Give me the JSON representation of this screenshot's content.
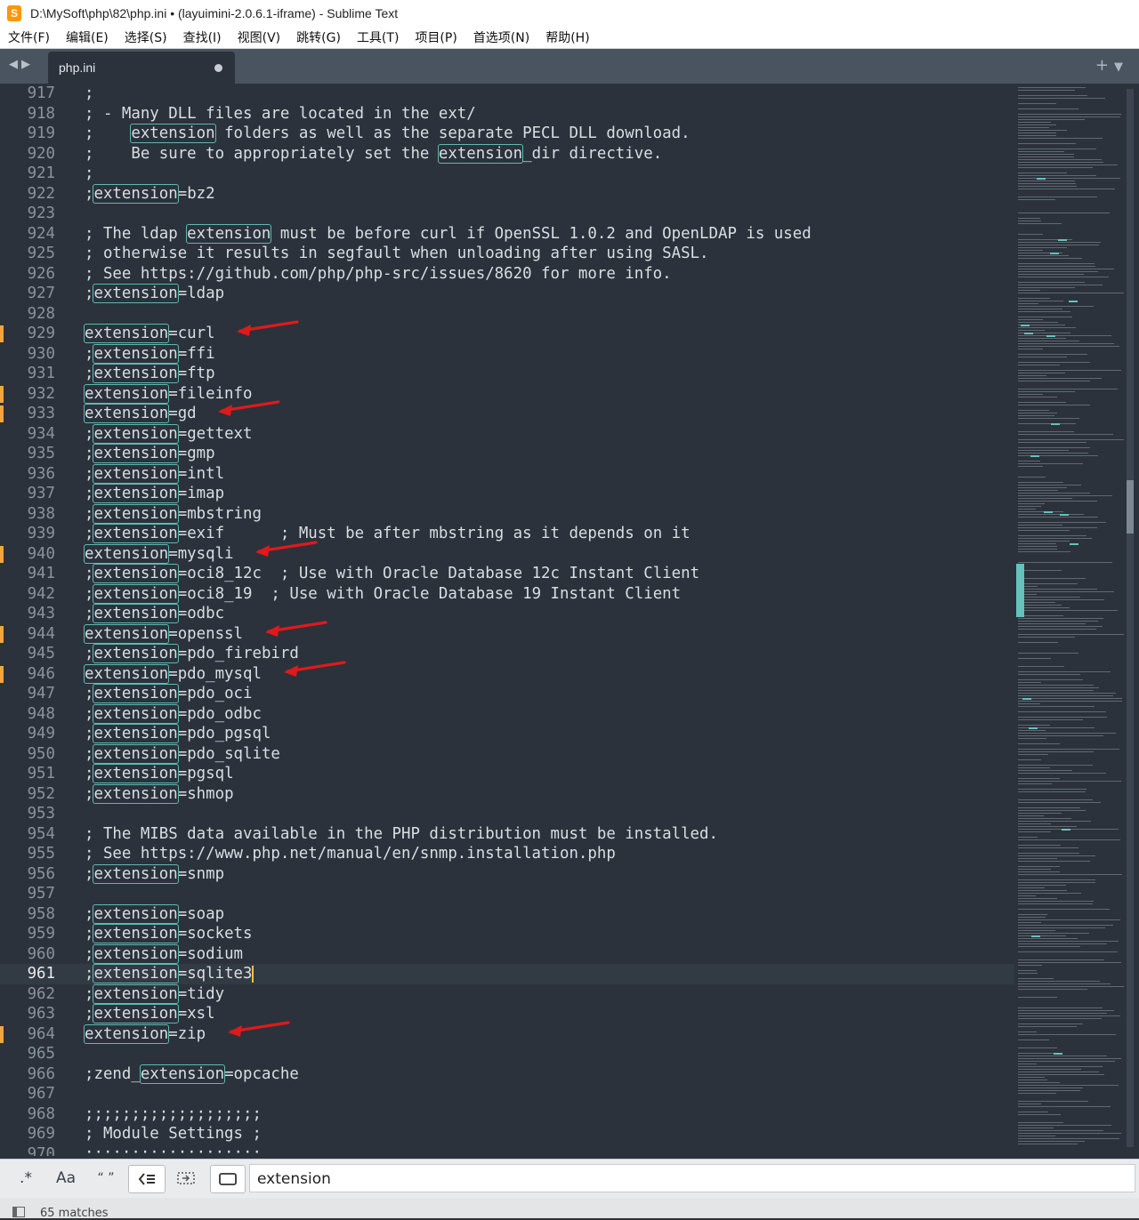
{
  "window": {
    "title": "D:\\MySoft\\php\\82\\php.ini • (layuimini-2.0.6.1-iframe) - Sublime Text",
    "app_icon": "S"
  },
  "menu": [
    "文件(F)",
    "编辑(E)",
    "选择(S)",
    "查找(I)",
    "视图(V)",
    "跳转(G)",
    "工具(T)",
    "项目(P)",
    "首选项(N)",
    "帮助(H)"
  ],
  "tab": {
    "label": "php.ini",
    "modified": true
  },
  "tab_controls": {
    "plus": "+",
    "dropdown": "▼"
  },
  "nav": {
    "back": "◀",
    "forward": "▶"
  },
  "highlight_term": "extension",
  "current_line": 961,
  "lines": [
    {
      "n": 917,
      "t": ";"
    },
    {
      "n": 918,
      "t": "; - Many DLL files are located in the ext/"
    },
    {
      "n": 919,
      "t": ";    extension folders as well as the separate PECL DLL download."
    },
    {
      "n": 920,
      "t": ";    Be sure to appropriately set the extension_dir directive."
    },
    {
      "n": 921,
      "t": ";"
    },
    {
      "n": 922,
      "t": ";extension=bz2"
    },
    {
      "n": 923,
      "t": ""
    },
    {
      "n": 924,
      "t": "; The ldap extension must be before curl if OpenSSL 1.0.2 and OpenLDAP is used"
    },
    {
      "n": 925,
      "t": "; otherwise it results in segfault when unloading after using SASL."
    },
    {
      "n": 926,
      "t": "; See https://github.com/php/php-src/issues/8620 for more info."
    },
    {
      "n": 927,
      "t": ";extension=ldap"
    },
    {
      "n": 928,
      "t": ""
    },
    {
      "n": 929,
      "t": "extension=curl",
      "mod": true
    },
    {
      "n": 930,
      "t": ";extension=ffi"
    },
    {
      "n": 931,
      "t": ";extension=ftp"
    },
    {
      "n": 932,
      "t": "extension=fileinfo",
      "mod": true
    },
    {
      "n": 933,
      "t": "extension=gd",
      "mod": true
    },
    {
      "n": 934,
      "t": ";extension=gettext"
    },
    {
      "n": 935,
      "t": ";extension=gmp"
    },
    {
      "n": 936,
      "t": ";extension=intl"
    },
    {
      "n": 937,
      "t": ";extension=imap"
    },
    {
      "n": 938,
      "t": ";extension=mbstring"
    },
    {
      "n": 939,
      "t": ";extension=exif      ; Must be after mbstring as it depends on it"
    },
    {
      "n": 940,
      "t": "extension=mysqli",
      "mod": true
    },
    {
      "n": 941,
      "t": ";extension=oci8_12c  ; Use with Oracle Database 12c Instant Client"
    },
    {
      "n": 942,
      "t": ";extension=oci8_19  ; Use with Oracle Database 19 Instant Client"
    },
    {
      "n": 943,
      "t": ";extension=odbc"
    },
    {
      "n": 944,
      "t": "extension=openssl",
      "mod": true
    },
    {
      "n": 945,
      "t": ";extension=pdo_firebird"
    },
    {
      "n": 946,
      "t": "extension=pdo_mysql",
      "mod": true
    },
    {
      "n": 947,
      "t": ";extension=pdo_oci"
    },
    {
      "n": 948,
      "t": ";extension=pdo_odbc"
    },
    {
      "n": 949,
      "t": ";extension=pdo_pgsql"
    },
    {
      "n": 950,
      "t": ";extension=pdo_sqlite"
    },
    {
      "n": 951,
      "t": ";extension=pgsql"
    },
    {
      "n": 952,
      "t": ";extension=shmop"
    },
    {
      "n": 953,
      "t": ""
    },
    {
      "n": 954,
      "t": "; The MIBS data available in the PHP distribution must be installed."
    },
    {
      "n": 955,
      "t": "; See https://www.php.net/manual/en/snmp.installation.php"
    },
    {
      "n": 956,
      "t": ";extension=snmp"
    },
    {
      "n": 957,
      "t": ""
    },
    {
      "n": 958,
      "t": ";extension=soap"
    },
    {
      "n": 959,
      "t": ";extension=sockets"
    },
    {
      "n": 960,
      "t": ";extension=sodium"
    },
    {
      "n": 961,
      "t": ";extension=sqlite3"
    },
    {
      "n": 962,
      "t": ";extension=tidy"
    },
    {
      "n": 963,
      "t": ";extension=xsl"
    },
    {
      "n": 964,
      "t": "extension=zip",
      "mod": true
    },
    {
      "n": 965,
      "t": ""
    },
    {
      "n": 966,
      "t": ";zend_extension=opcache"
    },
    {
      "n": 967,
      "t": ""
    },
    {
      "n": 968,
      "t": ";;;;;;;;;;;;;;;;;;;"
    },
    {
      "n": 969,
      "t": "; Module Settings ;"
    },
    {
      "n": 970,
      "t": ";;;;;;;;;;;;;;;;;;;"
    }
  ],
  "arrows_on_lines": [
    929,
    933,
    940,
    944,
    946,
    964
  ],
  "colors": {
    "editor_bg": "#2b323b",
    "highlight_outline": "#5fb8b3",
    "modified_marker": "#f4a442",
    "arrow": "#e0191b"
  },
  "find": {
    "regex": ".*",
    "case": "Aa",
    "whole_word": "“ ”",
    "wrap_icon": "wrap-icon",
    "in_selection_icon": "in-selection-icon",
    "highlight_icon": "highlight-matches-icon",
    "query": "extension"
  },
  "status": {
    "matches": "65 matches"
  }
}
